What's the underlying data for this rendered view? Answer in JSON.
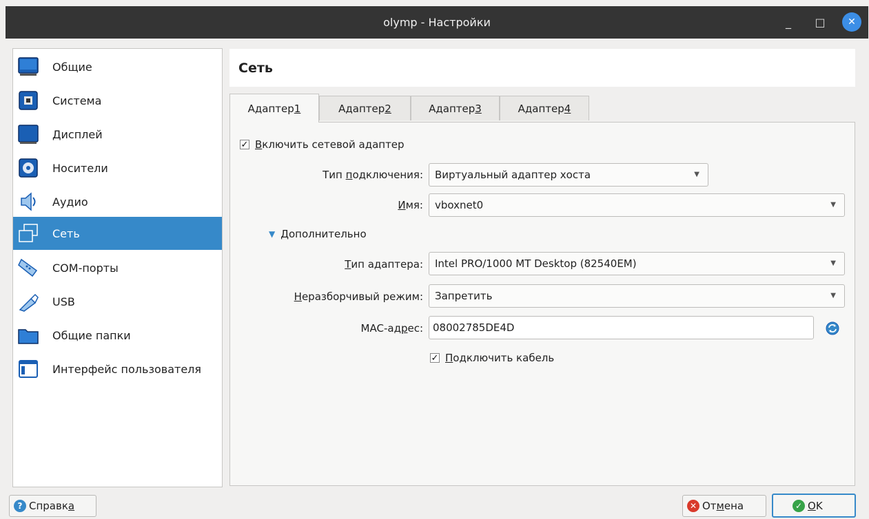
{
  "window": {
    "title": "olymp - Настройки"
  },
  "title_controls": {
    "minimize": "_",
    "maximize": "□",
    "close": "✕"
  },
  "sidebar": {
    "items": [
      {
        "label": "Общие",
        "icon": "general-icon"
      },
      {
        "label": "Система",
        "icon": "system-icon"
      },
      {
        "label": "Дисплей",
        "icon": "display-icon"
      },
      {
        "label": "Носители",
        "icon": "storage-icon"
      },
      {
        "label": "Аудио",
        "icon": "audio-icon"
      },
      {
        "label": "Сеть",
        "icon": "network-icon",
        "active": true
      },
      {
        "label": "COM-порты",
        "icon": "serial-ports-icon"
      },
      {
        "label": "USB",
        "icon": "usb-icon"
      },
      {
        "label": "Общие папки",
        "icon": "shared-folders-icon"
      },
      {
        "label": "Интерфейс пользователя",
        "icon": "user-interface-icon"
      }
    ]
  },
  "page": {
    "title": "Сеть"
  },
  "tabs": [
    {
      "label": "Адаптер ",
      "mnemonic": "1",
      "active": true
    },
    {
      "label": "Адаптер ",
      "mnemonic": "2"
    },
    {
      "label": "Адаптер ",
      "mnemonic": "3"
    },
    {
      "label": "Адаптер ",
      "mnemonic": "4"
    }
  ],
  "adapter": {
    "enable": {
      "pre": "",
      "mn": "В",
      "post": "ключить сетевой адаптер",
      "checked": true
    },
    "attached_to": {
      "label_pre": "Тип ",
      "label_mn": "п",
      "label_post": "одключения:",
      "value": "Виртуальный адаптер хоста"
    },
    "name": {
      "label_pre": "",
      "label_mn": "И",
      "label_post": "мя:",
      "value": "vboxnet0"
    },
    "advanced": {
      "mn": "Д",
      "post": "ополнительно"
    },
    "adapter_type": {
      "label_pre": "",
      "label_mn": "Т",
      "label_post": "ип адаптера:",
      "value": "Intel PRO/1000 MT Desktop (82540EM)"
    },
    "promiscuous": {
      "label_pre": "",
      "label_mn": "Н",
      "label_post": "еразборчивый режим:",
      "value": "Запретить"
    },
    "mac": {
      "label_pre": "MAC-ад",
      "label_mn": "р",
      "label_post": "ес:",
      "value": "08002785DE4D"
    },
    "cable": {
      "pre": "",
      "mn": "П",
      "post": "одключить кабель",
      "checked": true
    }
  },
  "buttons": {
    "help": {
      "pre": "Справк",
      "mn": "а",
      "post": ""
    },
    "cancel": {
      "pre": "От",
      "mn": "м",
      "post": "ена"
    },
    "ok": {
      "pre": "",
      "mn": "O",
      "post": "K"
    }
  },
  "colors": {
    "accent": "#3689c9",
    "titlebar": "#343434",
    "close_button": "#3c8ee6",
    "cancel_icon": "#d93a2b",
    "ok_icon": "#37a348",
    "help_icon": "#3689c9"
  }
}
